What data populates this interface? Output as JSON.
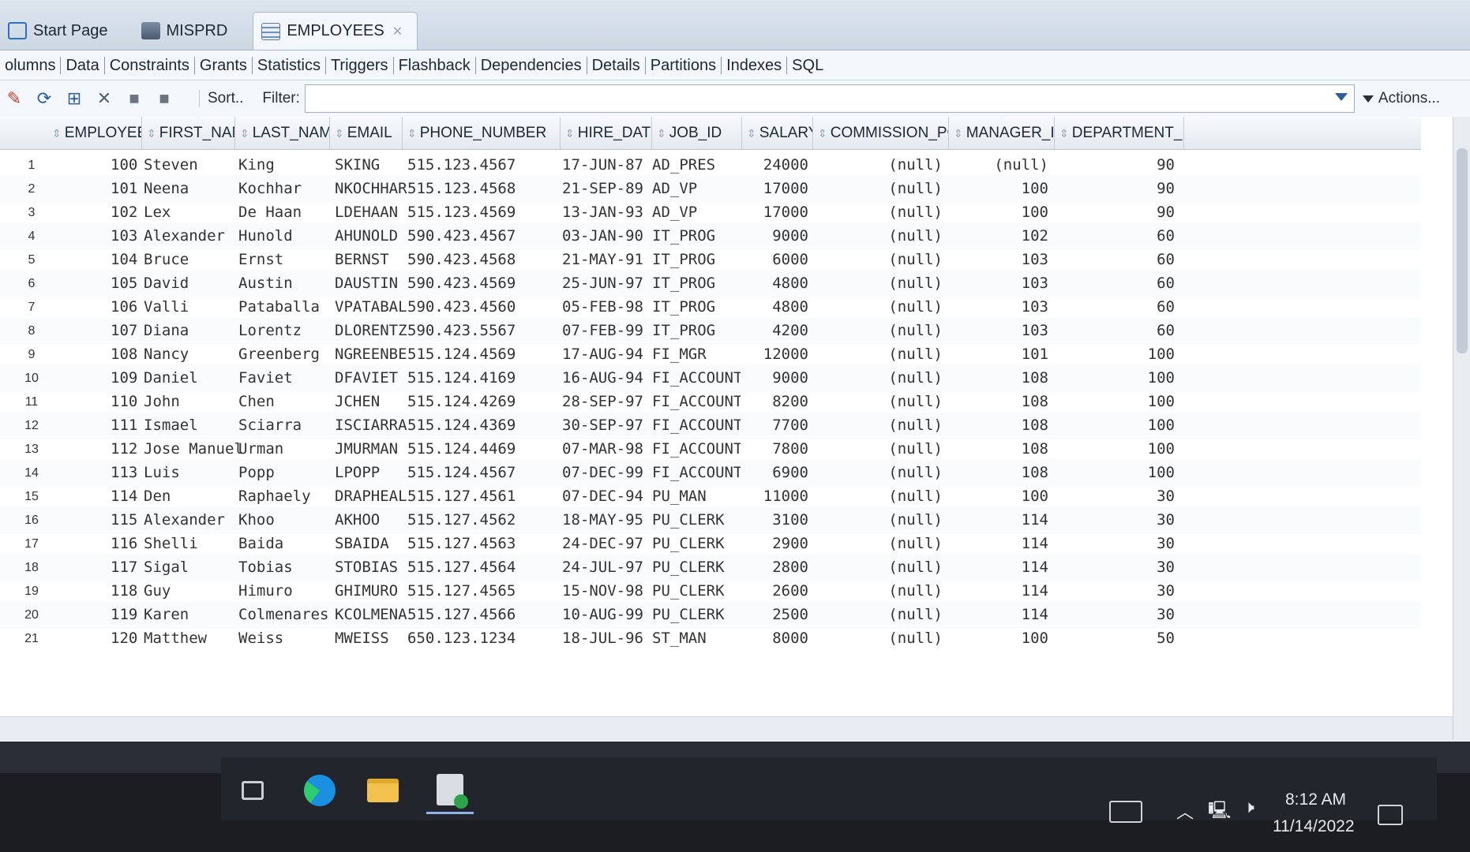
{
  "doc_tabs": [
    {
      "label": "Start Page",
      "icon": "start-page-icon"
    },
    {
      "label": "MISPRD",
      "icon": "connection-icon"
    },
    {
      "label": "EMPLOYEES",
      "icon": "table-icon",
      "active": true
    }
  ],
  "sub_tabs": [
    "olumns",
    "Data",
    "Constraints",
    "Grants",
    "Statistics",
    "Triggers",
    "Flashback",
    "Dependencies",
    "Details",
    "Partitions",
    "Indexes",
    "SQL"
  ],
  "toolbar": {
    "sort_label": "Sort..",
    "filter_label": "Filter:",
    "filter_value": "",
    "actions_label": "Actions..."
  },
  "grid": {
    "columns": [
      "EMPLOYEE_ID",
      "FIRST_NAME",
      "LAST_NAME",
      "EMAIL",
      "PHONE_NUMBER",
      "HIRE_DATE",
      "JOB_ID",
      "SALARY",
      "COMMISSION_PCT",
      "MANAGER_ID",
      "DEPARTMENT_ID"
    ],
    "rows": [
      [
        "1",
        "100",
        "Steven",
        "King",
        "SKING",
        "515.123.4567",
        "17-JUN-87",
        "AD_PRES",
        "24000",
        "(null)",
        "(null)",
        "90"
      ],
      [
        "2",
        "101",
        "Neena",
        "Kochhar",
        "NKOCHHAR",
        "515.123.4568",
        "21-SEP-89",
        "AD_VP",
        "17000",
        "(null)",
        "100",
        "90"
      ],
      [
        "3",
        "102",
        "Lex",
        "De Haan",
        "LDEHAAN",
        "515.123.4569",
        "13-JAN-93",
        "AD_VP",
        "17000",
        "(null)",
        "100",
        "90"
      ],
      [
        "4",
        "103",
        "Alexander",
        "Hunold",
        "AHUNOLD",
        "590.423.4567",
        "03-JAN-90",
        "IT_PROG",
        "9000",
        "(null)",
        "102",
        "60"
      ],
      [
        "5",
        "104",
        "Bruce",
        "Ernst",
        "BERNST",
        "590.423.4568",
        "21-MAY-91",
        "IT_PROG",
        "6000",
        "(null)",
        "103",
        "60"
      ],
      [
        "6",
        "105",
        "David",
        "Austin",
        "DAUSTIN",
        "590.423.4569",
        "25-JUN-97",
        "IT_PROG",
        "4800",
        "(null)",
        "103",
        "60"
      ],
      [
        "7",
        "106",
        "Valli",
        "Pataballa",
        "VPATABAL",
        "590.423.4560",
        "05-FEB-98",
        "IT_PROG",
        "4800",
        "(null)",
        "103",
        "60"
      ],
      [
        "8",
        "107",
        "Diana",
        "Lorentz",
        "DLORENTZ",
        "590.423.5567",
        "07-FEB-99",
        "IT_PROG",
        "4200",
        "(null)",
        "103",
        "60"
      ],
      [
        "9",
        "108",
        "Nancy",
        "Greenberg",
        "NGREENBE",
        "515.124.4569",
        "17-AUG-94",
        "FI_MGR",
        "12000",
        "(null)",
        "101",
        "100"
      ],
      [
        "10",
        "109",
        "Daniel",
        "Faviet",
        "DFAVIET",
        "515.124.4169",
        "16-AUG-94",
        "FI_ACCOUNT",
        "9000",
        "(null)",
        "108",
        "100"
      ],
      [
        "11",
        "110",
        "John",
        "Chen",
        "JCHEN",
        "515.124.4269",
        "28-SEP-97",
        "FI_ACCOUNT",
        "8200",
        "(null)",
        "108",
        "100"
      ],
      [
        "12",
        "111",
        "Ismael",
        "Sciarra",
        "ISCIARRA",
        "515.124.4369",
        "30-SEP-97",
        "FI_ACCOUNT",
        "7700",
        "(null)",
        "108",
        "100"
      ],
      [
        "13",
        "112",
        "Jose Manuel",
        "Urman",
        "JMURMAN",
        "515.124.4469",
        "07-MAR-98",
        "FI_ACCOUNT",
        "7800",
        "(null)",
        "108",
        "100"
      ],
      [
        "14",
        "113",
        "Luis",
        "Popp",
        "LPOPP",
        "515.124.4567",
        "07-DEC-99",
        "FI_ACCOUNT",
        "6900",
        "(null)",
        "108",
        "100"
      ],
      [
        "15",
        "114",
        "Den",
        "Raphaely",
        "DRAPHEAL",
        "515.127.4561",
        "07-DEC-94",
        "PU_MAN",
        "11000",
        "(null)",
        "100",
        "30"
      ],
      [
        "16",
        "115",
        "Alexander",
        "Khoo",
        "AKHOO",
        "515.127.4562",
        "18-MAY-95",
        "PU_CLERK",
        "3100",
        "(null)",
        "114",
        "30"
      ],
      [
        "17",
        "116",
        "Shelli",
        "Baida",
        "SBAIDA",
        "515.127.4563",
        "24-DEC-97",
        "PU_CLERK",
        "2900",
        "(null)",
        "114",
        "30"
      ],
      [
        "18",
        "117",
        "Sigal",
        "Tobias",
        "STOBIAS",
        "515.127.4564",
        "24-JUL-97",
        "PU_CLERK",
        "2800",
        "(null)",
        "114",
        "30"
      ],
      [
        "19",
        "118",
        "Guy",
        "Himuro",
        "GHIMURO",
        "515.127.4565",
        "15-NOV-98",
        "PU_CLERK",
        "2600",
        "(null)",
        "114",
        "30"
      ],
      [
        "20",
        "119",
        "Karen",
        "Colmenares",
        "KCOLMENA",
        "515.127.4566",
        "10-AUG-99",
        "PU_CLERK",
        "2500",
        "(null)",
        "114",
        "30"
      ],
      [
        "21",
        "120",
        "Matthew",
        "Weiss",
        "MWEISS",
        "650.123.1234",
        "18-JUL-96",
        "ST_MAN",
        "8000",
        "(null)",
        "100",
        "50"
      ]
    ]
  },
  "taskbar": {
    "apps": [
      "task-view-icon",
      "edge-browser-icon",
      "file-explorer-icon",
      "sql-developer-icon"
    ],
    "time": "8:12 AM",
    "date": "11/14/2022"
  }
}
